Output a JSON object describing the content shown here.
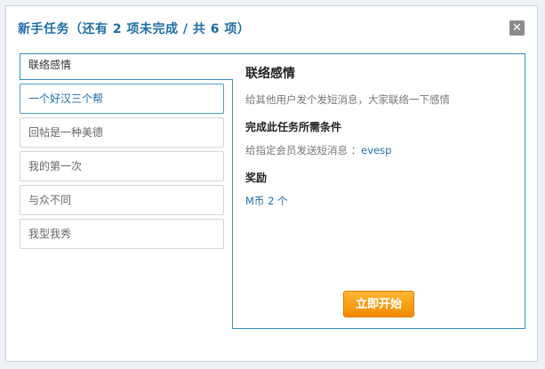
{
  "dialog": {
    "title": "新手任务（还有 2 项未完成 / 共 6 项）",
    "close_symbol": "✕"
  },
  "tabs": [
    {
      "label": "联络感情",
      "state": "active"
    },
    {
      "label": "一个好汉三个帮",
      "state": "selected"
    },
    {
      "label": "回帖是一种美德",
      "state": "normal"
    },
    {
      "label": "我的第一次",
      "state": "normal"
    },
    {
      "label": "与众不同",
      "state": "normal"
    },
    {
      "label": "我型我秀",
      "state": "normal"
    }
  ],
  "detail": {
    "title": "联络感情",
    "description": "给其他用户发个发短消息，大家联络一下感情",
    "condition_heading": "完成此任务所需条件",
    "condition_text": "给指定会员发送短消息 ：",
    "condition_user": "evesp",
    "reward_heading": "奖励",
    "reward_text": "M币 2 个",
    "start_button": "立即开始"
  },
  "colors": {
    "accent": "#1d6ea6",
    "panel_border": "#2d8fc4",
    "button_orange": "#f28a00"
  }
}
